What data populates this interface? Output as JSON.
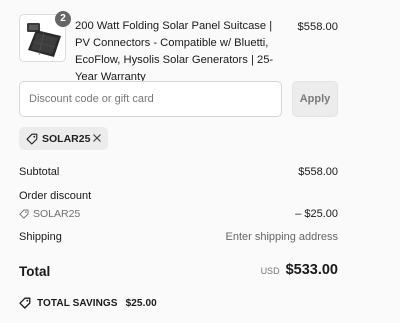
{
  "product": {
    "quantity": "2",
    "title": "200 Watt Folding Solar Panel Suitcase | PV Connectors - Compatible w/ Bluetti, EcoFlow, Hysolis Solar Generators | 25-Year Warranty",
    "price": "$558.00",
    "image_icon": "solar-panel-icon"
  },
  "discount": {
    "placeholder": "Discount code or gift card",
    "apply_label": "Apply",
    "applied_code": "SOLAR25"
  },
  "summary": {
    "subtotal_label": "Subtotal",
    "subtotal_value": "$558.00",
    "order_discount_label": "Order discount",
    "discount_code": "SOLAR25",
    "discount_value": "– $25.00",
    "shipping_label": "Shipping",
    "shipping_value": "Enter shipping address",
    "total_label": "Total",
    "currency": "USD",
    "total_value": "$533.00",
    "savings_label": "TOTAL SAVINGS",
    "savings_value": "$25.00"
  }
}
